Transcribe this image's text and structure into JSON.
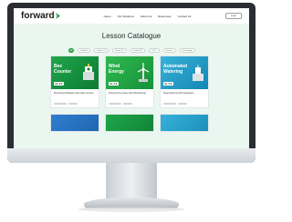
{
  "site": {
    "logo_text": "forward",
    "nav_links": [
      "Home",
      "Our Solutions",
      "About Us",
      "Resources",
      "Contact Us"
    ],
    "nav_button_label": "Login"
  },
  "page": {
    "title": "Lesson Catalogue",
    "filters": [
      "All",
      "Grade K",
      "Grade 1-2",
      "Grade 3-5",
      "Grade 6-8",
      "9-12",
      "Science",
      "Technology"
    ],
    "active_filter_index": 0
  },
  "cards": [
    {
      "image_title": "Bee Counter",
      "chip": "Gr. 3-5",
      "description": "Protecting Pollinators with a Bee Counter"
    },
    {
      "image_title": "Wind Energy",
      "chip": "Gr. 3-5",
      "description": "Powering the Future with Wind Energy"
    },
    {
      "image_title": "Automated Watering",
      "chip": "Gr. 3-5",
      "description": "Smart Farming with Automation"
    }
  ],
  "colors": {
    "accent": "#27a147",
    "hero_bg": "#eaf7f0",
    "monitor_bezel": "#2a2d31"
  }
}
